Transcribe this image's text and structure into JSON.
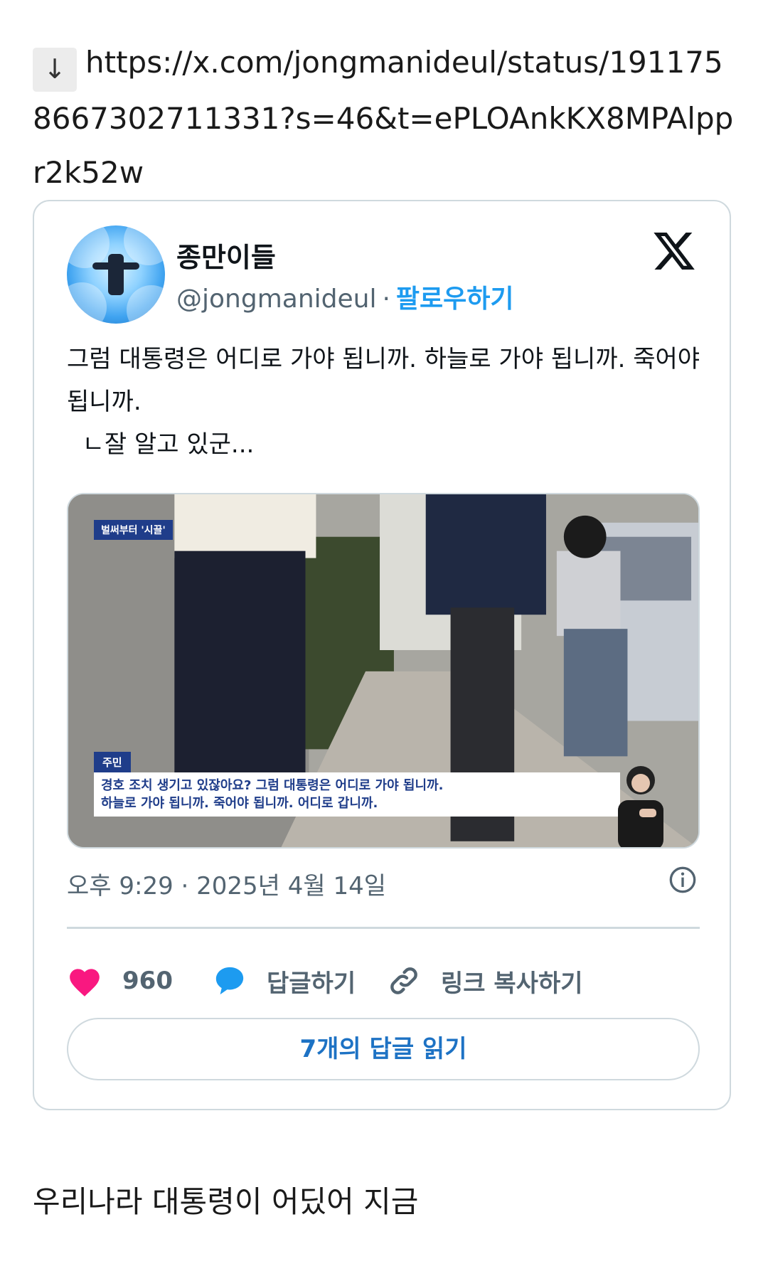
{
  "link": {
    "icon": "download-arrow-icon",
    "icon_glyph": "↓",
    "url": "https://x.com/jongmanideul/status/1911758667302711331?s=46&t=ePLOAnkKX8MPAlppr2k52w"
  },
  "tweet": {
    "author_name": "종만이들",
    "author_handle": "@jongmanideul",
    "separator": "·",
    "follow_label": "팔로우하기",
    "text": "그럼 대통령은 어디로 가야 됩니까. 하늘로 가야 됩니까. 죽어야 됩니까.\n  ㄴ잘 알고 있군...",
    "media": {
      "tag": "벌써부터 '시끌'",
      "speaker": "주민",
      "subtitle_line1": "경호 조치 생기고 있잖아요? 그럼 대통령은 어디로 가야 됩니까.",
      "subtitle_line2": "하늘로 가야 됩니까. 죽어야 됩니까. 어디로 갑니까."
    },
    "timestamp": "오후 9:29 · 2025년 4월 14일",
    "likes": "960",
    "reply_label": "답글하기",
    "copy_link_label": "링크 복사하기",
    "read_replies_label": "7개의 답글 읽기"
  },
  "colors": {
    "accent": "#1d9bf0",
    "like": "#f91880",
    "reply": "#1d9bf0",
    "border": "#cfd9de",
    "muted": "#536471"
  },
  "bottom_text": "우리나라 대통령이 어딨어 지금"
}
